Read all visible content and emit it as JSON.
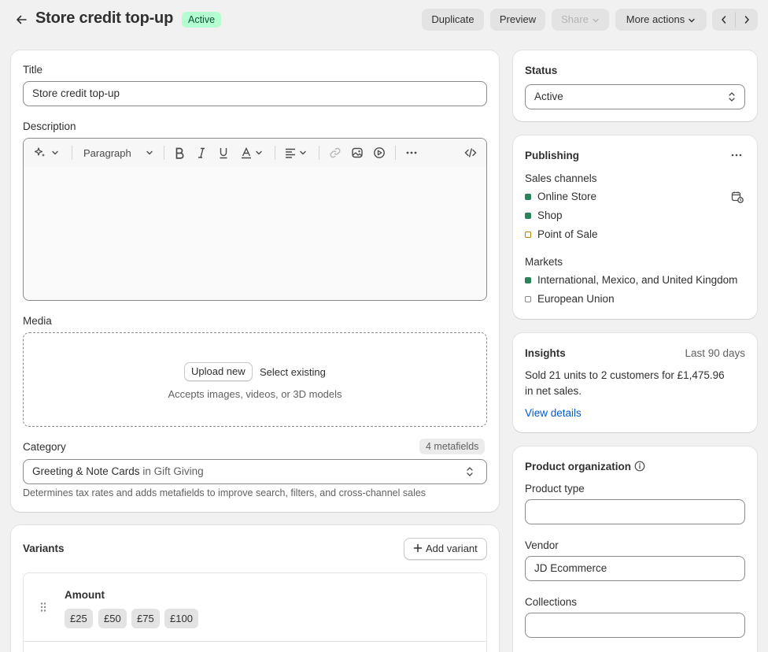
{
  "header": {
    "title": "Store credit top-up",
    "status_badge": "Active",
    "buttons": {
      "duplicate": "Duplicate",
      "preview": "Preview",
      "share": "Share",
      "more_actions": "More actions"
    }
  },
  "product": {
    "title_label": "Title",
    "title_value": "Store credit top-up",
    "description_label": "Description",
    "editor_toolbar": {
      "paragraph": "Paragraph"
    },
    "media_label": "Media",
    "upload_new": "Upload new",
    "select_existing": "Select existing",
    "media_hint": "Accepts images, videos, or 3D models",
    "category_label": "Category",
    "metafields_badge": "4 metafields",
    "category_value": "Greeting & Note Cards",
    "category_in": "in Gift Giving",
    "category_help": "Determines tax rates and adds metafields to improve search, filters, and cross-channel sales"
  },
  "variants": {
    "heading": "Variants",
    "add_variant": "Add variant",
    "option_name": "Amount",
    "values": [
      "£25",
      "£50",
      "£75",
      "£100"
    ]
  },
  "status_card": {
    "heading": "Status",
    "value": "Active"
  },
  "publishing": {
    "heading": "Publishing",
    "sales_channels_label": "Sales channels",
    "channels": [
      "Online Store",
      "Shop",
      "Point of Sale"
    ],
    "markets_label": "Markets",
    "markets": [
      "International, Mexico, and United Kingdom",
      "European Union"
    ],
    "colors": {
      "active": "#29845a",
      "pending": "#b28400",
      "inactive": "#8a8a8a"
    }
  },
  "insights": {
    "heading": "Insights",
    "period": "Last 90 days",
    "summary_line1": "Sold 21 units to 2 customers for £1,475.96",
    "summary_line2": "in net sales.",
    "view_details": "View details"
  },
  "organization": {
    "heading": "Product organization",
    "product_type_label": "Product type",
    "product_type_value": "",
    "vendor_label": "Vendor",
    "vendor_value": "JD Ecommerce",
    "collections_label": "Collections",
    "collections_value": ""
  }
}
